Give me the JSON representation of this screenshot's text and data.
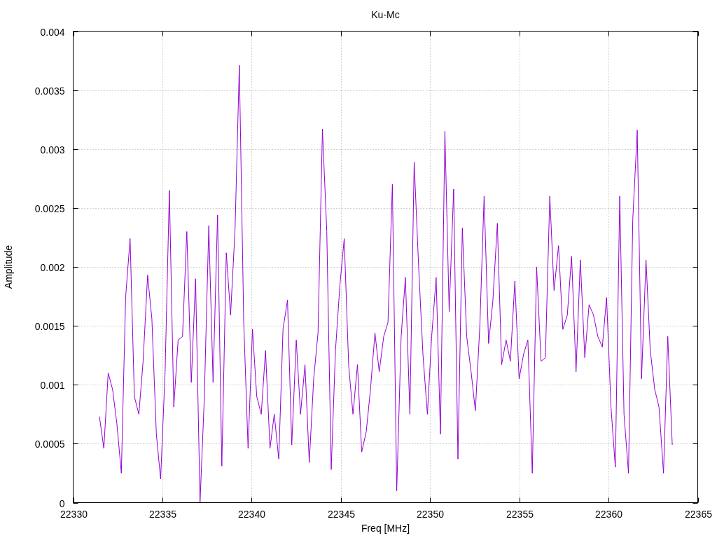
{
  "plot": {
    "chart_data": {
      "type": "line",
      "title": "Ku-Mc",
      "xlabel": "Freq [MHz]",
      "ylabel": "Amplitude",
      "grid": true,
      "xlim": [
        22330,
        22365
      ],
      "ylim": [
        0,
        0.004
      ],
      "xticks": [
        22330,
        22335,
        22340,
        22345,
        22350,
        22355,
        22360,
        22365
      ],
      "yticks": [
        {
          "value": 0,
          "label": "0"
        },
        {
          "value": 0.0005,
          "label": "0.0005"
        },
        {
          "value": 0.001,
          "label": "0.001"
        },
        {
          "value": 0.0015,
          "label": "0.0015"
        },
        {
          "value": 0.002,
          "label": "0.002"
        },
        {
          "value": 0.0025,
          "label": "0.0025"
        },
        {
          "value": 0.003,
          "label": "0.003"
        },
        {
          "value": 0.0035,
          "label": "0.0035"
        },
        {
          "value": 0.004,
          "label": "0.004"
        }
      ],
      "x": [
        22331.47,
        22331.72,
        22331.96,
        22332.21,
        22332.45,
        22332.7,
        22332.94,
        22333.19,
        22333.43,
        22333.68,
        22333.92,
        22334.17,
        22334.41,
        22334.66,
        22334.9,
        22335.15,
        22335.39,
        22335.64,
        22335.88,
        22336.13,
        22336.37,
        22336.62,
        22336.86,
        22337.11,
        22337.35,
        22337.6,
        22337.84,
        22338.09,
        22338.33,
        22338.58,
        22338.82,
        22339.07,
        22339.31,
        22339.56,
        22339.8,
        22340.05,
        22340.29,
        22340.54,
        22340.78,
        22341.03,
        22341.27,
        22341.52,
        22341.76,
        22342.01,
        22342.25,
        22342.5,
        22342.74,
        22342.99,
        22343.23,
        22343.48,
        22343.72,
        22343.97,
        22344.21,
        22344.46,
        22344.7,
        22344.95,
        22345.19,
        22345.44,
        22345.68,
        22345.93,
        22346.17,
        22346.42,
        22346.66,
        22346.91,
        22347.15,
        22347.4,
        22347.64,
        22347.89,
        22348.13,
        22348.38,
        22348.62,
        22348.87,
        22349.11,
        22349.36,
        22349.6,
        22349.85,
        22350.09,
        22350.34,
        22350.58,
        22350.83,
        22351.07,
        22351.32,
        22351.56,
        22351.81,
        22352.05,
        22352.3,
        22352.54,
        22352.79,
        22353.03,
        22353.28,
        22353.52,
        22353.77,
        22354.01,
        22354.26,
        22354.5,
        22354.75,
        22354.99,
        22355.24,
        22355.48,
        22355.73,
        22355.97,
        22356.22,
        22356.46,
        22356.71,
        22356.95,
        22357.2,
        22357.44,
        22357.69,
        22357.93,
        22358.18,
        22358.42,
        22358.67,
        22358.91,
        22359.16,
        22359.4,
        22359.65,
        22359.89,
        22360.14,
        22360.38,
        22360.63,
        22360.87,
        22361.12,
        22361.36,
        22361.61,
        22361.85,
        22362.1,
        22362.34,
        22362.59,
        22362.83,
        22363.08,
        22363.32,
        22363.57
      ],
      "series": [
        {
          "color": "#9400d3",
          "values": [
            0.00073,
            0.00046,
            0.0011,
            0.00096,
            0.00067,
            0.00025,
            0.00174,
            0.00224,
            0.0009,
            0.00075,
            0.0012,
            0.00193,
            0.00156,
            0.00058,
            0.0002,
            0.00111,
            0.00265,
            0.00081,
            0.00138,
            0.00141,
            0.0023,
            0.00102,
            0.0019,
            0,
            0.00089,
            0.00235,
            0.00102,
            0.00244,
            0.00031,
            0.00212,
            0.00159,
            0.00232,
            0.00371,
            0.00153,
            0.00046,
            0.00147,
            0.0009,
            0.00075,
            0.00129,
            0.00046,
            0.00075,
            0.00037,
            0.00147,
            0.00172,
            0.00049,
            0.00138,
            0.00075,
            0.00117,
            0.00034,
            0.00105,
            0.00144,
            0.00317,
            0.0023,
            0.00028,
            0.00129,
            0.00185,
            0.00224,
            0.00116,
            0.00075,
            0.00117,
            0.00043,
            0.0006,
            0.00096,
            0.00144,
            0.00111,
            0.00141,
            0.00153,
            0.0027,
            0.0001,
            0.00141,
            0.00191,
            0.00075,
            0.00289,
            0.002,
            0.00126,
            0.00075,
            0.00141,
            0.00191,
            0.00058,
            0.00315,
            0.00162,
            0.00266,
            0.00037,
            0.00233,
            0.00141,
            0.00111,
            0.00078,
            0.0015,
            0.0026,
            0.00135,
            0.00171,
            0.00237,
            0.00117,
            0.00138,
            0.0012,
            0.00188,
            0.00105,
            0.00126,
            0.00138,
            0.00025,
            0.002,
            0.0012,
            0.00123,
            0.0026,
            0.0018,
            0.00218,
            0.00147,
            0.00159,
            0.00209,
            0.00111,
            0.00206,
            0.00123,
            0.00168,
            0.00159,
            0.00141,
            0.00132,
            0.00174,
            0.00081,
            0.0003,
            0.0026,
            0.00075,
            0.00025,
            0.0024,
            0.00316,
            0.00105,
            0.00206,
            0.00129,
            0.00096,
            0.00081,
            0.00025,
            0.00141,
            0.00049
          ]
        }
      ]
    }
  }
}
